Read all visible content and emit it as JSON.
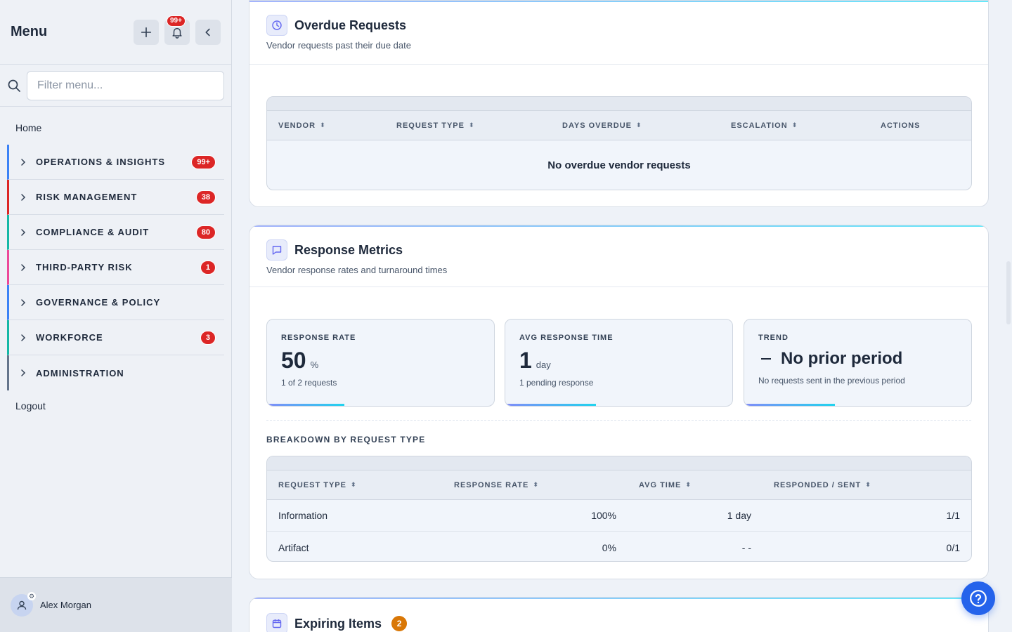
{
  "sidebar": {
    "title": "Menu",
    "notif_count": "99+",
    "filter_placeholder": "Filter menu...",
    "home": "Home",
    "items": [
      {
        "label": "OPERATIONS & INSIGHTS",
        "badge": "99+",
        "color": "#3b82f6"
      },
      {
        "label": "RISK MANAGEMENT",
        "badge": "38",
        "color": "#dc2626"
      },
      {
        "label": "COMPLIANCE & AUDIT",
        "badge": "80",
        "color": "#14b8a6"
      },
      {
        "label": "THIRD-PARTY RISK",
        "badge": "1",
        "color": "#ec4899"
      },
      {
        "label": "GOVERNANCE & POLICY",
        "badge": "",
        "color": "#3b82f6"
      },
      {
        "label": "WORKFORCE",
        "badge": "3",
        "color": "#14b8a6"
      },
      {
        "label": "ADMINISTRATION",
        "badge": "",
        "color": "#64748b"
      }
    ],
    "logout": "Logout",
    "user_name": "Alex Morgan"
  },
  "overdue": {
    "title": "Overdue Requests",
    "subtitle": "Vendor requests past their due date",
    "columns": [
      "VENDOR",
      "REQUEST TYPE",
      "DAYS OVERDUE",
      "ESCALATION",
      "ACTIONS"
    ],
    "empty_message": "No overdue vendor requests"
  },
  "metrics": {
    "title": "Response Metrics",
    "subtitle": "Vendor response rates and turnaround times",
    "response_rate": {
      "label": "RESPONSE RATE",
      "value": "50",
      "unit": "%",
      "note": "1 of 2 requests",
      "progress": 0.34
    },
    "avg_time": {
      "label": "AVG RESPONSE TIME",
      "value": "1",
      "unit": "day",
      "note": "1 pending response",
      "progress": 0.4
    },
    "trend": {
      "label": "TREND",
      "value": "No prior period",
      "note": "No requests sent in the previous period",
      "progress": 0.4
    },
    "breakdown_label": "BREAKDOWN BY REQUEST TYPE",
    "breakdown_columns": [
      "REQUEST TYPE",
      "RESPONSE RATE",
      "AVG TIME",
      "RESPONDED / SENT"
    ],
    "breakdown_rows": [
      {
        "type": "Information",
        "rate": "100%",
        "avg": "1 day",
        "ratio": "1/1"
      },
      {
        "type": "Artifact",
        "rate": "0%",
        "avg": "- -",
        "ratio": "0/1"
      }
    ]
  },
  "expiring": {
    "title": "Expiring Items",
    "count": "2"
  }
}
